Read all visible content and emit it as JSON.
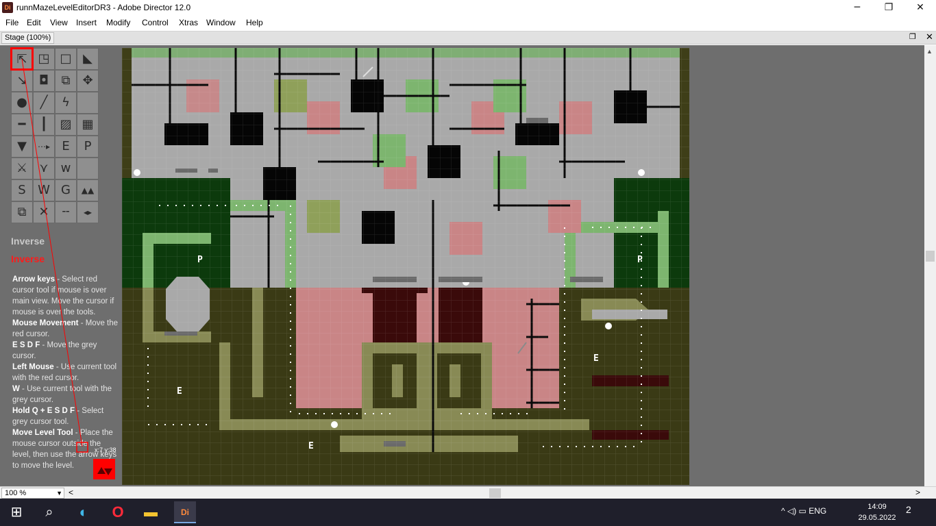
{
  "window": {
    "title": "runnMazeLevelEditorDR3 - Adobe Director 12.0",
    "app_icon_label": "Di",
    "min_glyph": "─",
    "max_glyph": "❐",
    "close_glyph": "✕"
  },
  "menu": [
    "File",
    "Edit",
    "View",
    "Insert",
    "Modify",
    "Control",
    "Xtras",
    "Window",
    "Help"
  ],
  "stage": {
    "title": "Stage (100%)",
    "restore_glyph": "❐",
    "close_glyph": "✕"
  },
  "palette": {
    "tools": [
      {
        "icon": "move-arrows-icon",
        "glyph": "⇱"
      },
      {
        "icon": "square-corner-icon",
        "glyph": "◳"
      },
      {
        "icon": "square-outline-icon",
        "glyph": "□"
      },
      {
        "icon": "triangle-icon",
        "glyph": "◣"
      },
      {
        "icon": "arrow-down-right-icon",
        "glyph": "↘"
      },
      {
        "icon": "square-filled-icon",
        "glyph": "◘"
      },
      {
        "icon": "copy-squares-icon",
        "glyph": "⧉"
      },
      {
        "icon": "move-cross-icon",
        "glyph": "✥"
      },
      {
        "icon": "ball-icon",
        "glyph": "●"
      },
      {
        "icon": "slash-icon",
        "glyph": "╱"
      },
      {
        "icon": "lightning-icon",
        "glyph": "ϟ"
      },
      {
        "icon": "empty-icon",
        "glyph": ""
      },
      {
        "icon": "horizontal-bar-icon",
        "glyph": "━"
      },
      {
        "icon": "vertical-bar-icon",
        "glyph": "┃"
      },
      {
        "icon": "hatched-square-icon",
        "glyph": "▨"
      },
      {
        "icon": "grid-square-icon",
        "glyph": "▦"
      },
      {
        "icon": "shield-down-icon",
        "glyph": "▼"
      },
      {
        "icon": "dotted-arrow-icon",
        "glyph": "⋯▸"
      },
      {
        "icon": "letter-e-icon",
        "glyph": "E"
      },
      {
        "icon": "letter-p-icon",
        "glyph": "P"
      },
      {
        "icon": "crossed-blades-icon",
        "glyph": "⚔"
      },
      {
        "icon": "bat-icon",
        "glyph": "⋎"
      },
      {
        "icon": "letter-w-small-icon",
        "glyph": "w"
      },
      {
        "icon": "empty-icon",
        "glyph": ""
      },
      {
        "icon": "letter-s-icon",
        "glyph": "S"
      },
      {
        "icon": "letter-w-icon",
        "glyph": "W"
      },
      {
        "icon": "letter-g-icon",
        "glyph": "G"
      },
      {
        "icon": "spikes-icon",
        "glyph": "▲▲"
      },
      {
        "icon": "stacked-squares-icon",
        "glyph": "⧉"
      },
      {
        "icon": "cross-out-icon",
        "glyph": "✕"
      },
      {
        "icon": "dashed-line-icon",
        "glyph": "╌"
      },
      {
        "icon": "left-right-arrows-icon",
        "glyph": "◂▸"
      }
    ]
  },
  "help": {
    "inverse_label_grey": "Inverse",
    "inverse_label_red": "Inverse",
    "entries": [
      {
        "key": "Arrow keys",
        "desc": " - Select red cursor tool if mouse is over main view. Move the cursor if mouse is over the tools."
      },
      {
        "key": "Mouse Movement",
        "desc": " - Move the red cursor."
      },
      {
        "key": "E S D F",
        "desc": " - Move the grey cursor."
      },
      {
        "key": "Left Mouse",
        "desc": " - Use current tool with the red cursor."
      },
      {
        "key": "W",
        "desc": " - Use current tool with the grey cursor."
      },
      {
        "key": "Hold Q + E S D F",
        "desc": " - Select grey cursor tool."
      },
      {
        "key": "Move Level Tool",
        "desc": " - Place the mouse cursor outside the level, then use the arrow keys to move the level."
      }
    ]
  },
  "cursor_readout": "x:7 y:38",
  "level_labels": {
    "p_left": "P",
    "p_right": "P",
    "e_left": "E",
    "e_bottom": "E",
    "e_right": "E"
  },
  "bottombar": {
    "zoom": "100 %",
    "left_arrow": "<",
    "right_arrow": ">"
  },
  "taskbar": {
    "start_glyph": "⊞",
    "search_glyph": "⌕",
    "edge_glyph": "◐",
    "opera_glyph": "O",
    "explorer_glyph": "▬",
    "director_label": "Di",
    "tray_text": "^  ◁)  ▭  ENG",
    "time": "14:09",
    "date": "29.05.2022",
    "notify_glyph": "2"
  },
  "colors": {
    "bg_olive": "#3a3a15",
    "mid_olive": "#888a55",
    "dark_green": "#0b3a0b",
    "light_green": "#7db56f",
    "pink": "#c98586",
    "grey_area": "#a8a8a8",
    "dark_maroon": "#3a0a0a",
    "cursor_red": "#ff0000"
  }
}
